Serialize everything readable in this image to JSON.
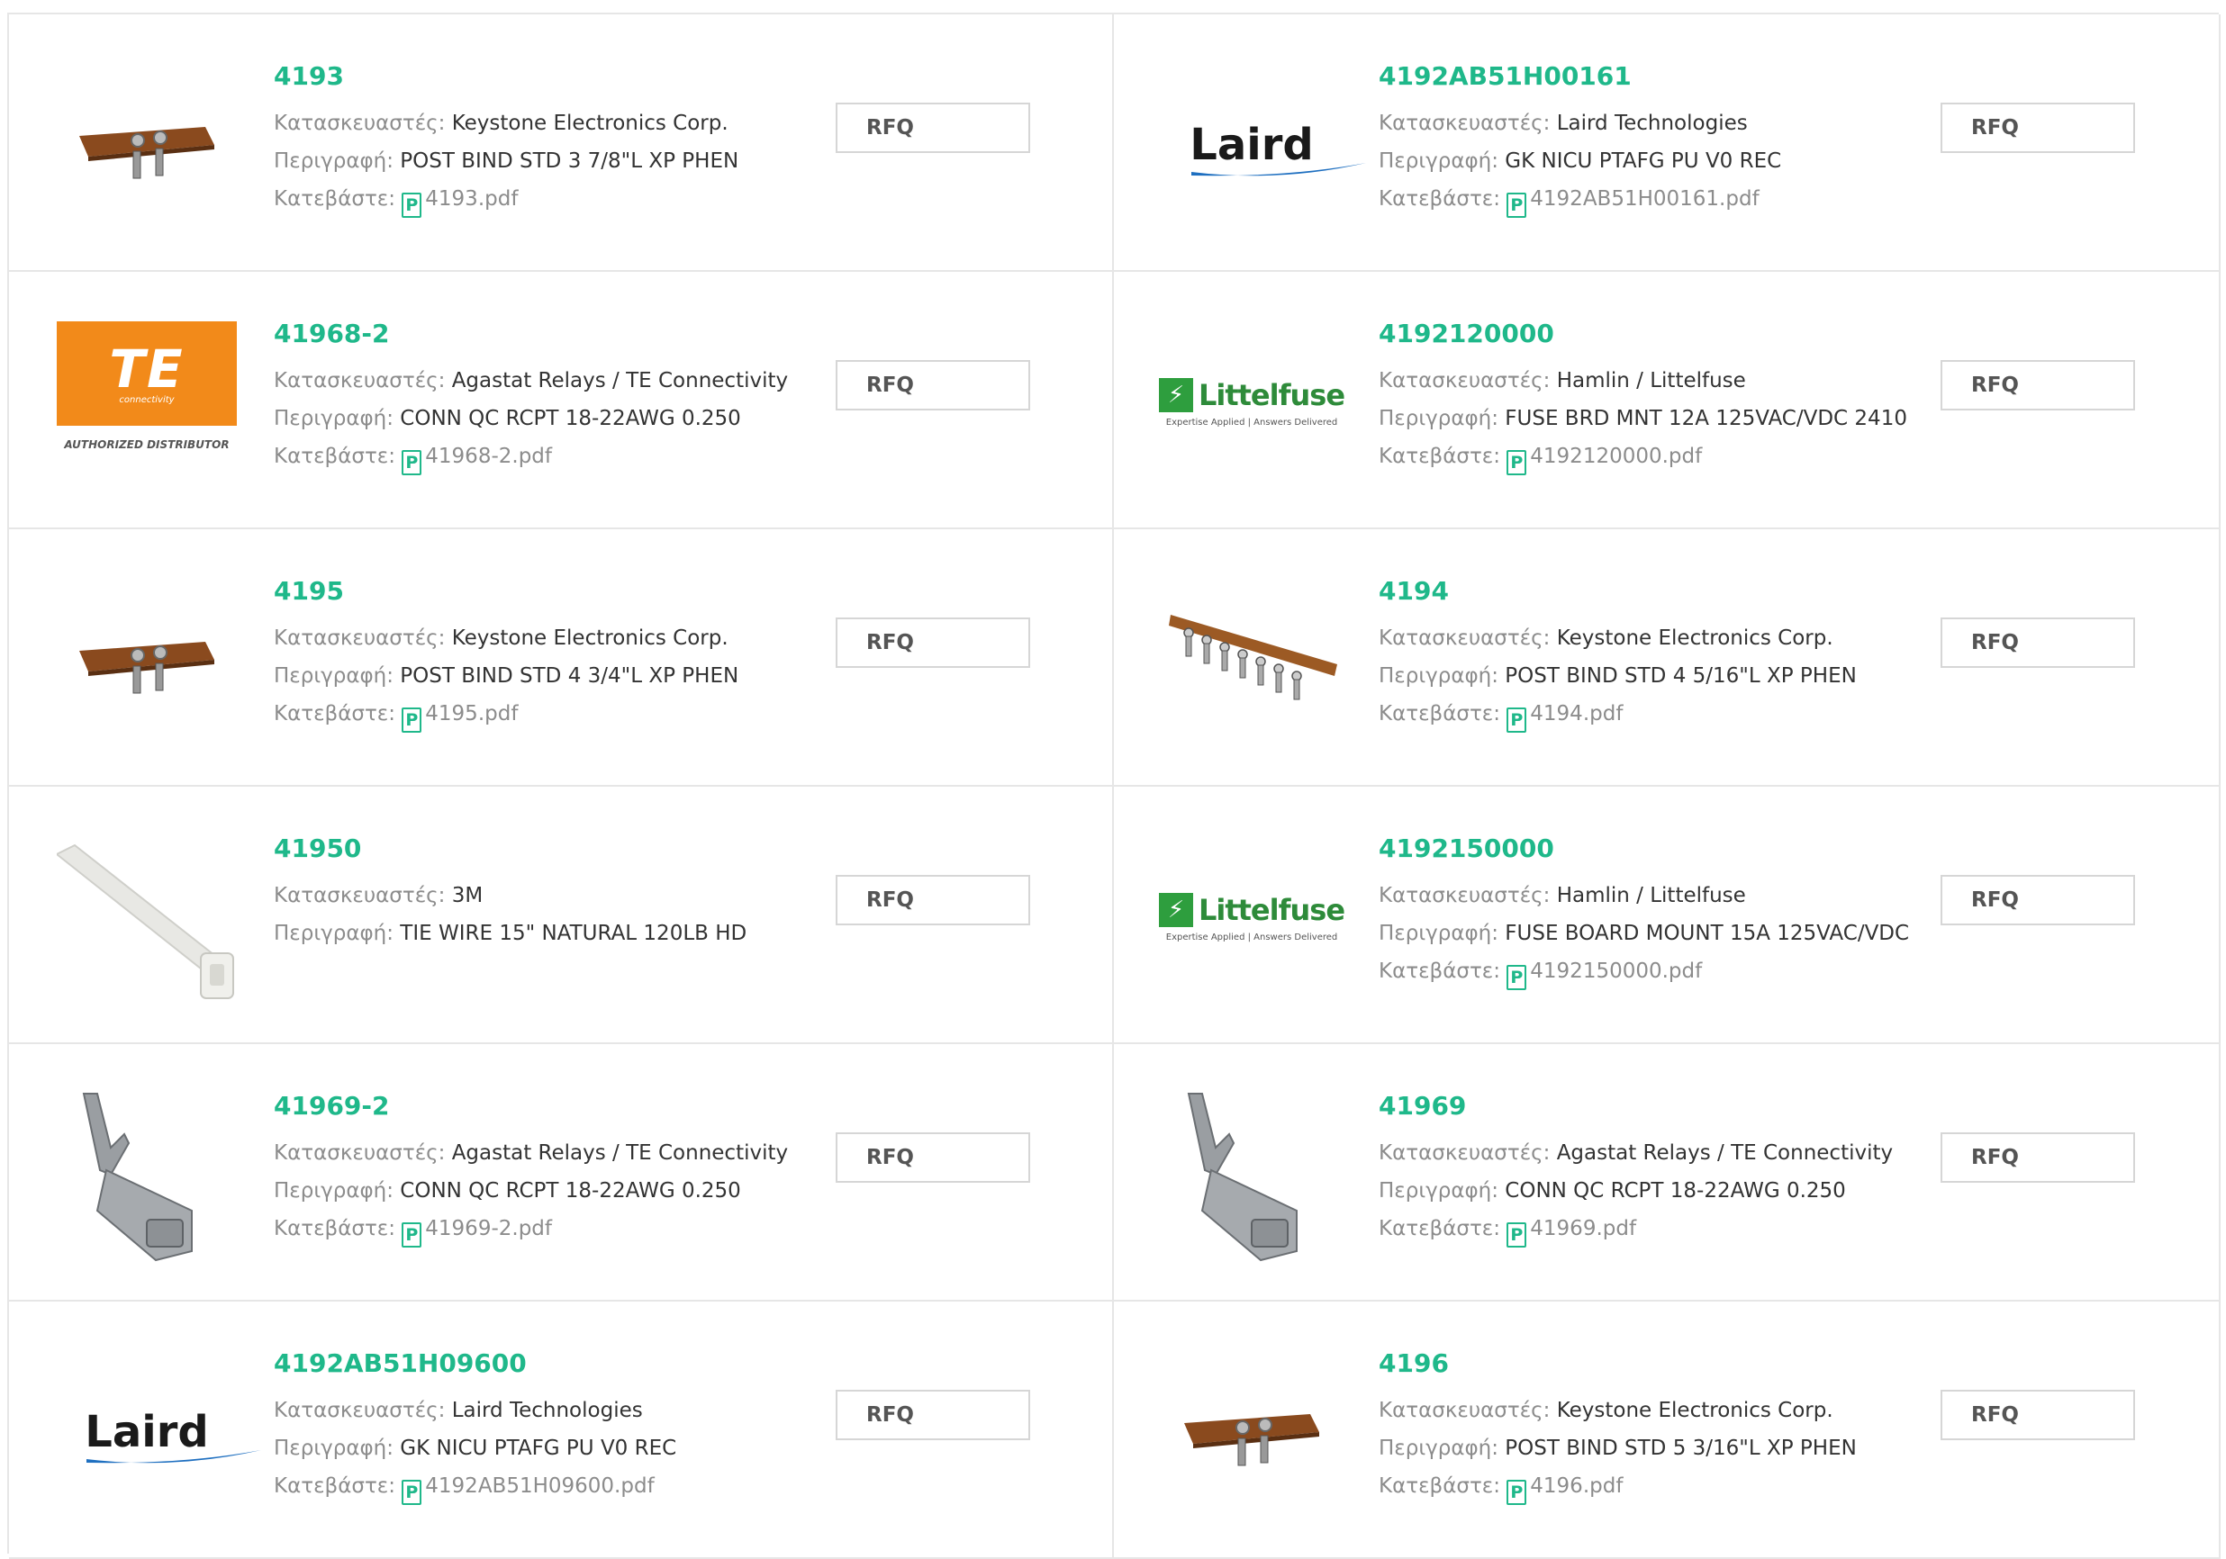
{
  "labels": {
    "manufacturer": "Κατασκευαστές:",
    "description": "Περιγραφή:",
    "download": "Κατεβάστε:",
    "rfq": "RFQ",
    "pdf_icon": "P"
  },
  "products": [
    {
      "part": "4193",
      "manufacturer": "Keystone Electronics Corp.",
      "description": "POST BIND STD 3 7/8\"L XP PHEN",
      "pdf": "4193.pdf",
      "image": "terminal-board-short"
    },
    {
      "part": "4192AB51H00161",
      "manufacturer": "Laird Technologies",
      "description": "GK NICU PTAFG PU V0 REC",
      "pdf": "4192AB51H00161.pdf",
      "image": "laird-logo"
    },
    {
      "part": "41968-2",
      "manufacturer": "Agastat Relays / TE Connectivity",
      "description": "CONN QC RCPT 18-22AWG 0.250",
      "pdf": "41968-2.pdf",
      "image": "te-logo"
    },
    {
      "part": "4192120000",
      "manufacturer": "Hamlin / Littelfuse",
      "description": "FUSE BRD MNT 12A 125VAC/VDC 2410",
      "pdf": "4192120000.pdf",
      "image": "littelfuse-logo"
    },
    {
      "part": "4195",
      "manufacturer": "Keystone Electronics Corp.",
      "description": "POST BIND STD 4 3/4\"L XP PHEN",
      "pdf": "4195.pdf",
      "image": "terminal-board-short"
    },
    {
      "part": "4194",
      "manufacturer": "Keystone Electronics Corp.",
      "description": "POST BIND STD 4 5/16\"L XP PHEN",
      "pdf": "4194.pdf",
      "image": "terminal-board-long"
    },
    {
      "part": "41950",
      "manufacturer": "3M",
      "description": "TIE WIRE 15\" NATURAL 120LB HD",
      "pdf": "",
      "image": "cable-tie"
    },
    {
      "part": "4192150000",
      "manufacturer": "Hamlin / Littelfuse",
      "description": "FUSE BOARD MOUNT 15A 125VAC/VDC",
      "pdf": "4192150000.pdf",
      "image": "littelfuse-logo"
    },
    {
      "part": "41969-2",
      "manufacturer": "Agastat Relays / TE Connectivity",
      "description": "CONN QC RCPT 18-22AWG 0.250",
      "pdf": "41969-2.pdf",
      "image": "quick-connect"
    },
    {
      "part": "41969",
      "manufacturer": "Agastat Relays / TE Connectivity",
      "description": "CONN QC RCPT 18-22AWG 0.250",
      "pdf": "41969.pdf",
      "image": "quick-connect"
    },
    {
      "part": "4192AB51H09600",
      "manufacturer": "Laird Technologies",
      "description": "GK NICU PTAFG PU V0 REC",
      "pdf": "4192AB51H09600.pdf",
      "image": "laird-logo"
    },
    {
      "part": "4196",
      "manufacturer": "Keystone Electronics Corp.",
      "description": "POST BIND STD 5 3/16\"L XP PHEN",
      "pdf": "4196.pdf",
      "image": "terminal-board-short"
    }
  ],
  "logos": {
    "laird": "Laird",
    "te": "TE",
    "te_sub": "connectivity",
    "te_auth": "AUTHORIZED DISTRIBUTOR",
    "littelfuse": "Littelfuse",
    "littelfuse_tag": "Expertise Applied | Answers Delivered"
  },
  "colors": {
    "accent": "#1fb88a",
    "label": "#8c8c8c",
    "text": "#333333",
    "border": "#e6e6e6",
    "te_orange": "#f28a1a",
    "littelfuse_green": "#2e9e3e",
    "laird_blue": "#1e6fc0"
  }
}
